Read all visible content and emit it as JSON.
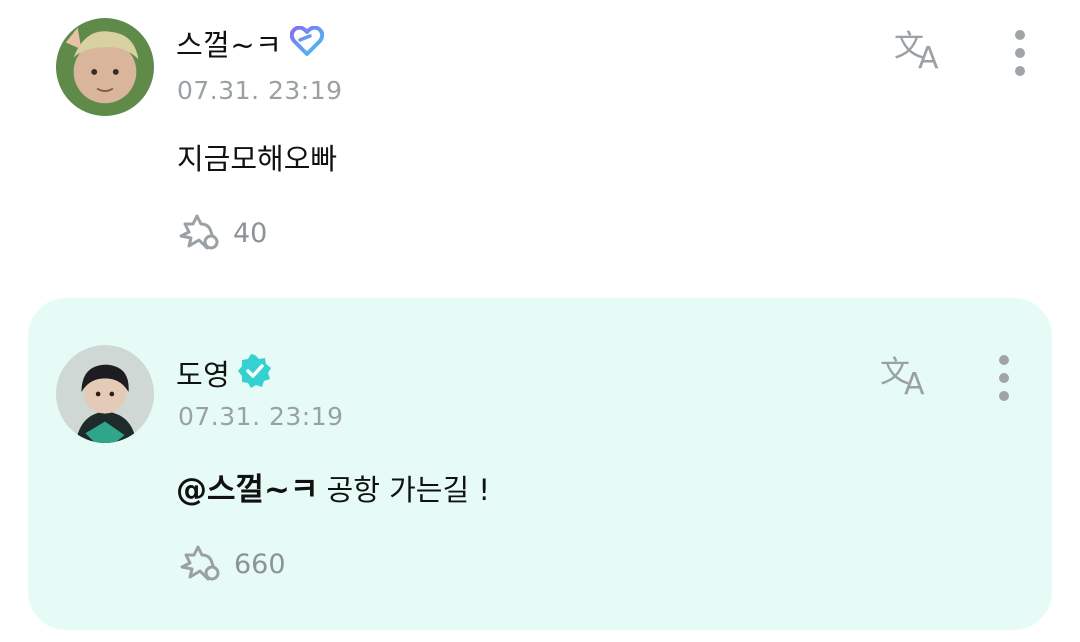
{
  "comments": [
    {
      "username": "스껄~ㅋ",
      "badge_icon": "heart-membership-icon",
      "timestamp": "07.31. 23:19",
      "text": "지금모해오빠",
      "likes": "40",
      "highlighted": false
    },
    {
      "username": "도영",
      "badge_icon": "verified-badge-icon",
      "timestamp": "07.31. 23:19",
      "mention": "@스껄~ㅋ",
      "text": "공항 가는길 !",
      "likes": "660",
      "highlighted": true
    }
  ],
  "colors": {
    "highlight_bg": "#e6fbf6",
    "verified": "#35d1d1",
    "muted": "#9aa0a3"
  }
}
